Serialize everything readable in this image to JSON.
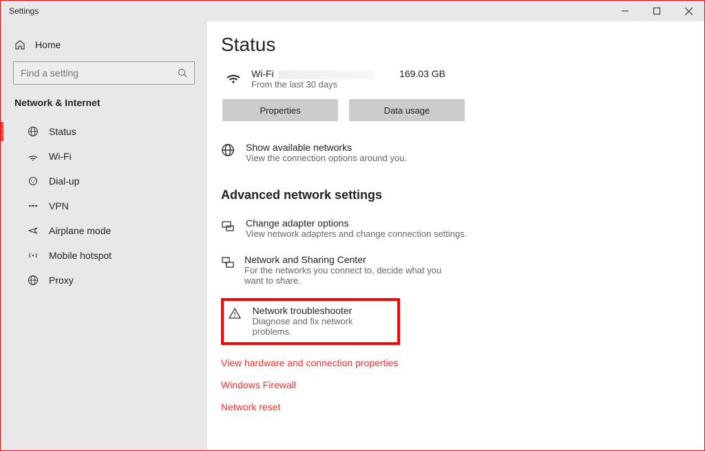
{
  "window": {
    "title": "Settings"
  },
  "sidebar": {
    "home_label": "Home",
    "search_placeholder": "Find a setting",
    "section_title": "Network & Internet",
    "items": [
      {
        "label": "Status"
      },
      {
        "label": "Wi-Fi"
      },
      {
        "label": "Dial-up"
      },
      {
        "label": "VPN"
      },
      {
        "label": "Airplane mode"
      },
      {
        "label": "Mobile hotspot"
      },
      {
        "label": "Proxy"
      }
    ]
  },
  "main": {
    "page_title": "Status",
    "wifi": {
      "label": "Wi-Fi",
      "subtext": "From the last 30 days",
      "usage": "169.03 GB"
    },
    "buttons": {
      "properties": "Properties",
      "data_usage": "Data usage"
    },
    "show_networks": {
      "title": "Show available networks",
      "desc": "View the connection options around you."
    },
    "advanced_heading": "Advanced network settings",
    "adapter": {
      "title": "Change adapter options",
      "desc": "View network adapters and change connection settings."
    },
    "sharing": {
      "title": "Network and Sharing Center",
      "desc": "For the networks you connect to, decide what you want to share."
    },
    "troubleshooter": {
      "title": "Network troubleshooter",
      "desc": "Diagnose and fix network problems."
    },
    "links": {
      "hw": "View hardware and connection properties",
      "firewall": "Windows Firewall",
      "reset": "Network reset"
    }
  }
}
